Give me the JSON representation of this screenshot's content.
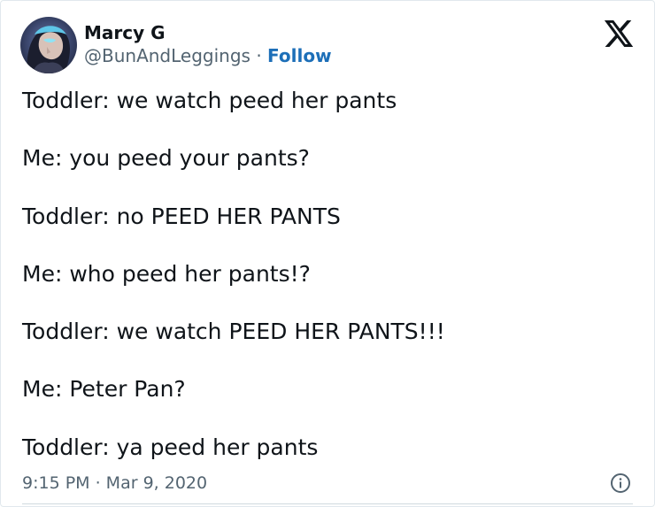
{
  "author": {
    "name": "Marcy G",
    "handle": "@BunAndLeggings",
    "separator": " · ",
    "follow_label": "Follow",
    "avatar_icon": "profile-photo"
  },
  "tweet": {
    "lines": [
      "Toddler: we watch peed her pants",
      "Me: you peed your pants?",
      "Toddler: no PEED HER PANTS",
      "Me: who peed her pants!?",
      "Toddler: we watch PEED HER PANTS!!!",
      "Me: Peter Pan?",
      "Toddler: ya peed her pants"
    ]
  },
  "meta": {
    "timestamp": "9:15 PM · Mar 9, 2020"
  },
  "icons": {
    "brand": "x-logo-icon",
    "info": "info-icon"
  },
  "colors": {
    "text": "#0f1419",
    "secondary": "#536471",
    "follow": "#1d6fb8"
  }
}
